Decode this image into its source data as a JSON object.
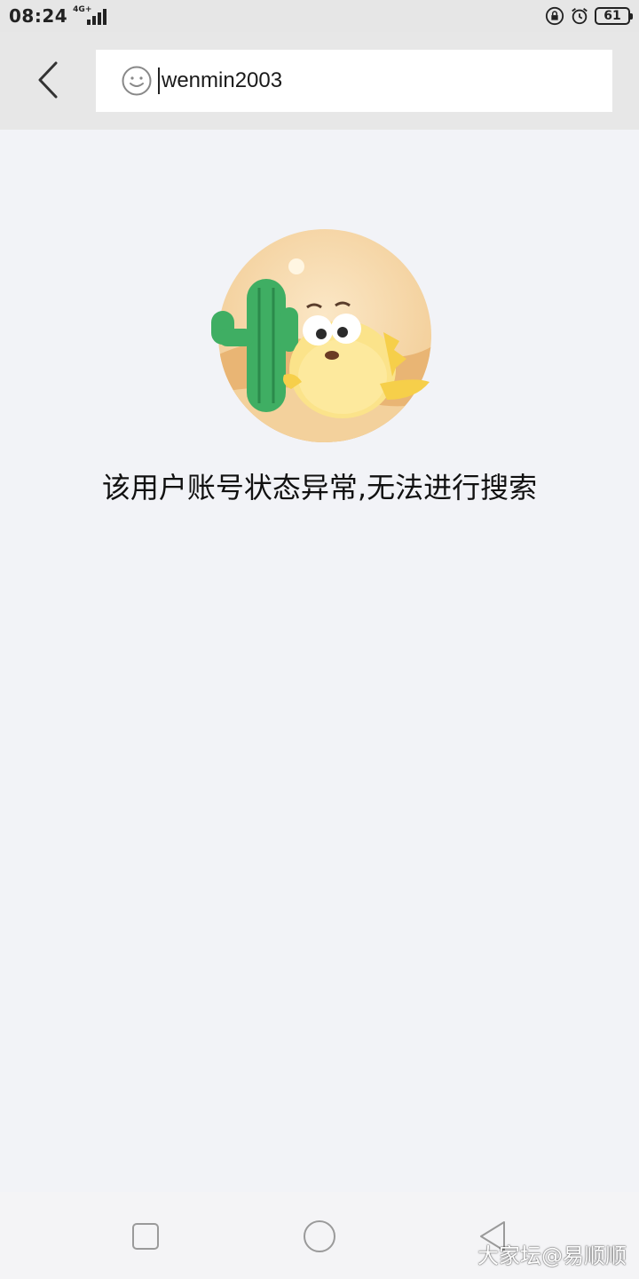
{
  "status_bar": {
    "time": "08:24",
    "network": "4G+",
    "battery": "61",
    "icons": [
      "lock-rotation-icon",
      "alarm-icon",
      "battery-icon"
    ]
  },
  "search": {
    "back_icon": "chevron-left-icon",
    "avatar_icon": "smiley-face-icon",
    "query": "wenmin2003"
  },
  "result": {
    "illustration": "cactus-and-yellow-fish-illustration",
    "message": "该用户账号状态异常,无法进行搜索"
  },
  "nav_bar": {
    "icons": [
      "square-recent-apps-icon",
      "circle-home-icon",
      "triangle-back-icon"
    ]
  },
  "watermark": "大家坛@易顺顺",
  "colors": {
    "page_bg": "#f2f3f7",
    "header_bg": "#e7e7e7",
    "search_bg": "#ffffff"
  }
}
